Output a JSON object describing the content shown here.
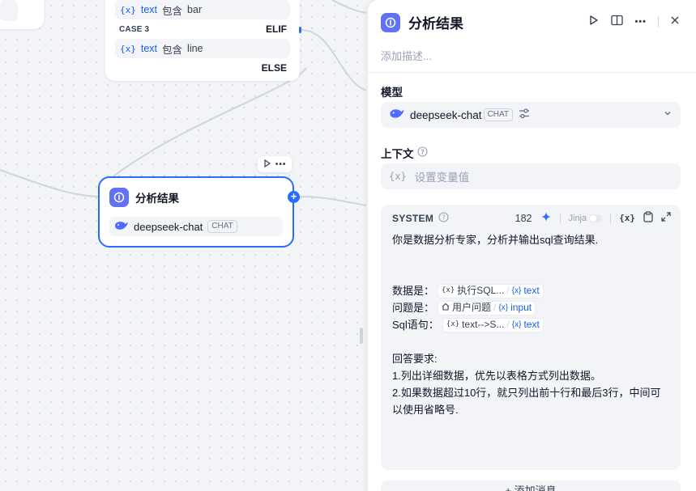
{
  "canvas": {
    "if_node": {
      "cond1": {
        "var_mark": "{x}",
        "var": "text",
        "op": "包含",
        "value": "bar"
      },
      "case3_label": "CASE 3",
      "elif_label": "ELIF",
      "cond2": {
        "var_mark": "{x}",
        "var": "text",
        "op": "包含",
        "value": "line"
      },
      "else_label": "ELSE"
    },
    "llm_node": {
      "title": "分析结果",
      "model": "deepseek-chat",
      "badge": "CHAT"
    }
  },
  "panel": {
    "title": "分析结果",
    "description_placeholder": "添加描述...",
    "model_label": "模型",
    "model_name": "deepseek-chat",
    "model_badge": "CHAT",
    "context_label": "上下文",
    "context_var_mark": "{x}",
    "context_placeholder": "设置变量值",
    "prompt": {
      "role": "SYSTEM",
      "token_count": "182",
      "jinja_label": "Jinja",
      "var_button": "{x}",
      "lines": {
        "l1": "你是数据分析专家，分析并输出sql查询结果.",
        "l2_label": "数据是：",
        "l2_node": "执行SQL...",
        "l2_var": "text",
        "l3_label": "问题是：",
        "l3_node": "用户问题",
        "l3_var": "input",
        "l4_label": "Sql语句：",
        "l4_node": "text-->S...",
        "l4_var": "text",
        "l5": "回答要求:",
        "l6": "1.列出详细数据，优先以表格方式列出数据。",
        "l7": "2.如果数据超过10行，就只列出前十行和最后3行，中间可以使用省略号."
      }
    },
    "add_message": "+ 添加消息"
  },
  "colors": {
    "accent": "#296dff",
    "node_icon": "#6172f3",
    "var_blue": "#155eef"
  },
  "icons": [
    "llm-node-icon",
    "whale-icon",
    "run-icon",
    "panel-toggle-icon",
    "more-icon",
    "close-icon",
    "sliders-icon",
    "chevron-down-icon",
    "help-icon",
    "sparkle-icon",
    "clipboard-icon",
    "expand-icon",
    "home-icon"
  ]
}
